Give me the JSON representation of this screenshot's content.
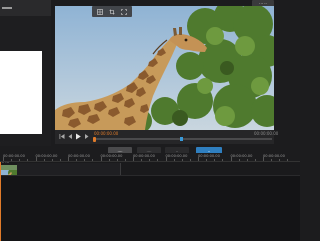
{
  "topbar": {
    "right_button_label": "··· ··"
  },
  "preview": {
    "toolbar_icons": [
      "grid-icon",
      "crop-icon",
      "fullscreen-icon"
    ]
  },
  "playback": {
    "current_time": "00:00:00.00",
    "duration": "00:00:00.00",
    "position_fraction": 0.0
  },
  "actions": {
    "btn_a": "····",
    "btn_b": "····",
    "btn_c": "··",
    "btn_d": "··"
  },
  "ruler": {
    "labels": [
      "00:00:00.00",
      "00:00:00.00",
      "00:00:00.00",
      "00:00:00.00",
      "00:00:00.00",
      "00:00:00.00",
      "00:00:00.00",
      "00:00:00.00",
      "00:00:00.00"
    ]
  },
  "timeline": {
    "clip_label": "·· ···"
  },
  "colors": {
    "accent_orange": "#e07b2a",
    "accent_blue": "#2f7fc0",
    "background": "#1c1c1e"
  }
}
